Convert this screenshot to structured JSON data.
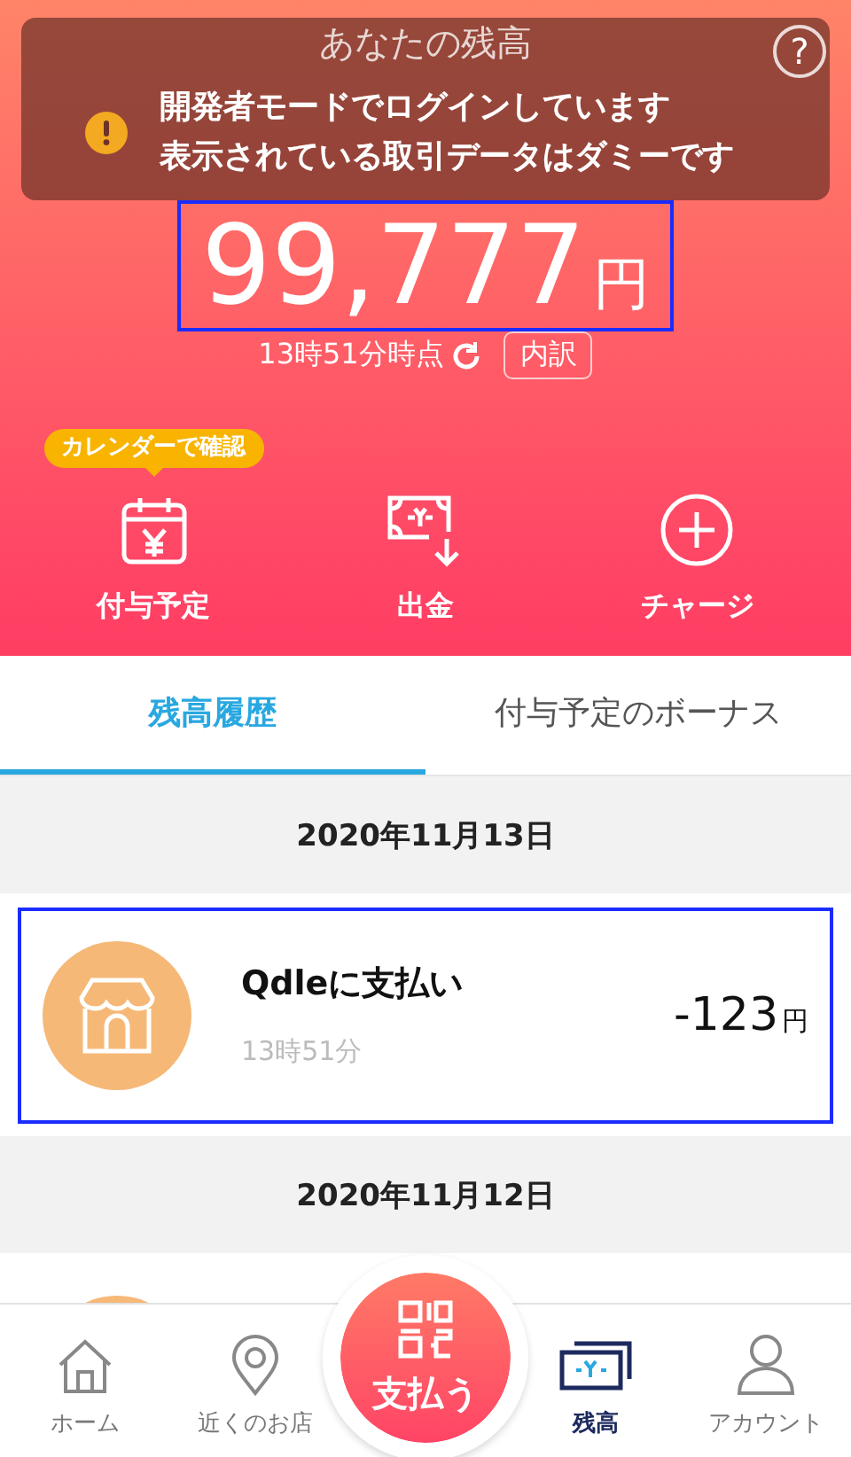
{
  "header": {
    "title": "あなたの残高",
    "help_icon": "?",
    "notice": {
      "lines": [
        "開発者モードでログインしています",
        "表示されている取引データはダミーです"
      ]
    },
    "balance": {
      "amount": "99,777",
      "unit": "円",
      "highlighted": true
    },
    "as_of": "13時51分時点",
    "breakdown_button": "内訳",
    "actions": [
      {
        "kind": "calendar",
        "label": "付与予定",
        "tooltip": "カレンダーで確認"
      },
      {
        "kind": "withdraw",
        "label": "出金"
      },
      {
        "kind": "charge",
        "label": "チャージ"
      }
    ]
  },
  "tabs": [
    {
      "label": "残高履歴",
      "selected": true
    },
    {
      "label": "付与予定のボーナス",
      "selected": false
    }
  ],
  "history": [
    {
      "date": "2020年11月13日",
      "transactions": [
        {
          "kind": "store",
          "title": "Qdleに支払い",
          "time": "13時51分",
          "amount": "-123",
          "unit": "円",
          "highlighted": true
        }
      ]
    },
    {
      "date": "2020年11月12日",
      "transactions": [
        {
          "kind": "store"
        }
      ]
    }
  ],
  "nav": [
    {
      "kind": "home",
      "label": "ホーム",
      "selected": false
    },
    {
      "kind": "pin",
      "label": "近くのお店",
      "selected": false
    },
    {
      "kind": "pay",
      "label": "支払う",
      "selected": false
    },
    {
      "kind": "balance",
      "label": "残高",
      "selected": true
    },
    {
      "kind": "account",
      "label": "アカウント",
      "selected": false
    }
  ]
}
